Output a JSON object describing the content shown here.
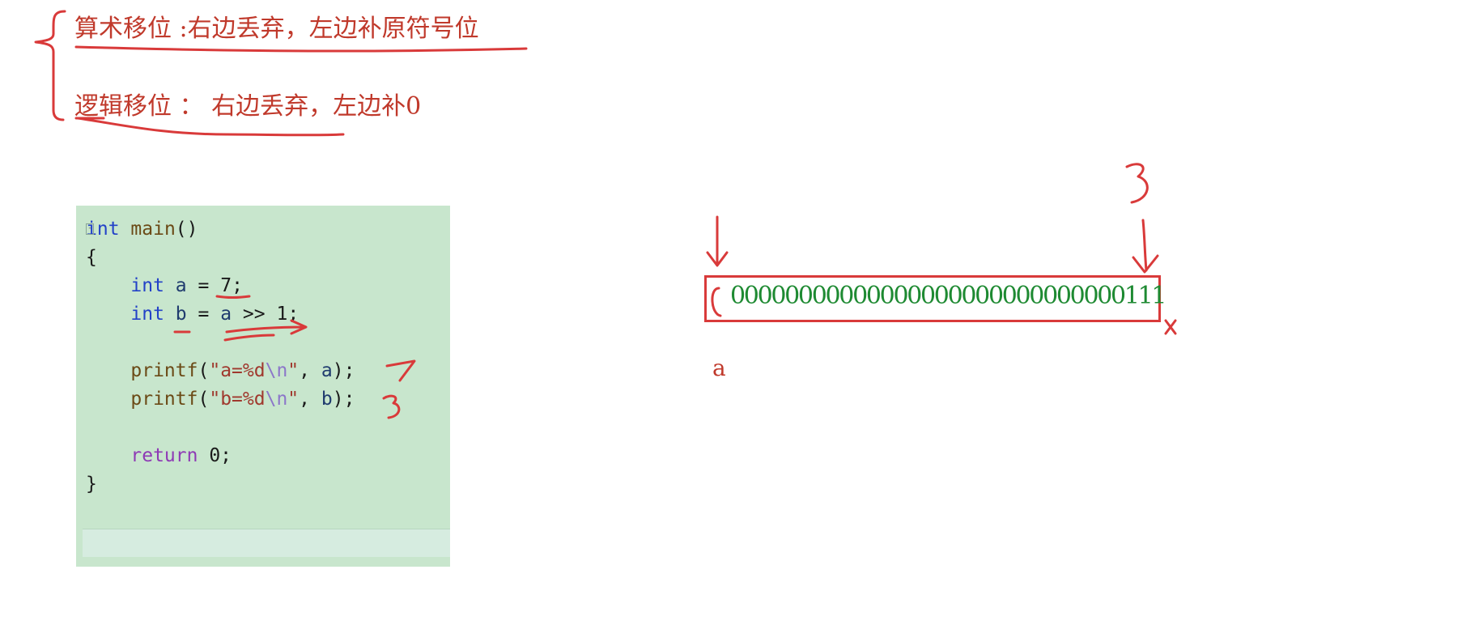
{
  "notes": {
    "arithmetic_shift": {
      "term": "算术移位",
      "rule": " :右边丢弃，左边补原符号位"
    },
    "logical_shift": {
      "term": "逻辑移位",
      "rule": " ： 右边丢弃，左边补0"
    }
  },
  "code": {
    "kw_int": "int",
    "fn_main": "main",
    "parens": "()",
    "brace_open": "{",
    "brace_close": "}",
    "var_a": "a",
    "var_b": "b",
    "eq": " = ",
    "val_7": "7",
    "semi": ";",
    "shift_op": " >> ",
    "val_1": "1",
    "fn_printf": "printf",
    "str_a_prefix": "\"a=%d",
    "str_b_prefix": "\"b=%d",
    "escape_n": "\\n",
    "quote_close": "\"",
    "arg_sep": ", ",
    "call_close": ");",
    "kw_return": "return",
    "val_0": " 0;",
    "fold_marker": "-"
  },
  "annotations": {
    "a_output": "7",
    "b_output": "3",
    "right_marker": "3",
    "dropped_bit": "x"
  },
  "bits": {
    "value": "00000000000000000000000000000111"
  },
  "var_label": "a",
  "colors": {
    "ink_red": "#d93a3a",
    "bit_green": "#1e8a32",
    "panel_green": "#c8e6cd"
  }
}
